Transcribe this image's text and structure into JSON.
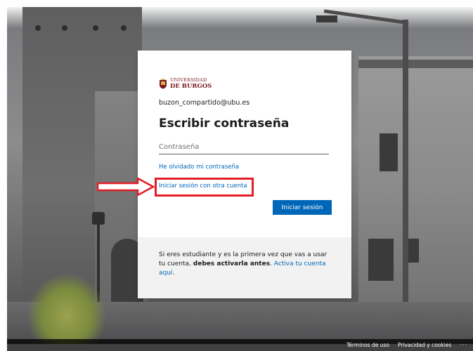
{
  "logo": {
    "line1": "UNIVERSIDAD",
    "line2": "DE BURGOS"
  },
  "account_email": "buzon_compartido@ubu.es",
  "heading": "Escribir contraseña",
  "password_field": {
    "placeholder": "Contraseña",
    "value": ""
  },
  "links": {
    "forgot_password": "He olvidado mi contraseña",
    "other_account": "Iniciar sesión con otra cuenta"
  },
  "signin_button": "Iniciar sesión",
  "info": {
    "part1": "Si eres estudiante y es la primera vez que vas a usar tu cuenta,",
    "bold": "debes activarla antes",
    "part2": ".",
    "link": "Activa tu cuenta aquí",
    "part3": "."
  },
  "footer": {
    "terms": "Términos de uso",
    "privacy": "Privacidad y cookies",
    "more": "···"
  },
  "colors": {
    "accent": "#0067b8",
    "highlight": "#e31e24",
    "brand": "#7a1720"
  }
}
